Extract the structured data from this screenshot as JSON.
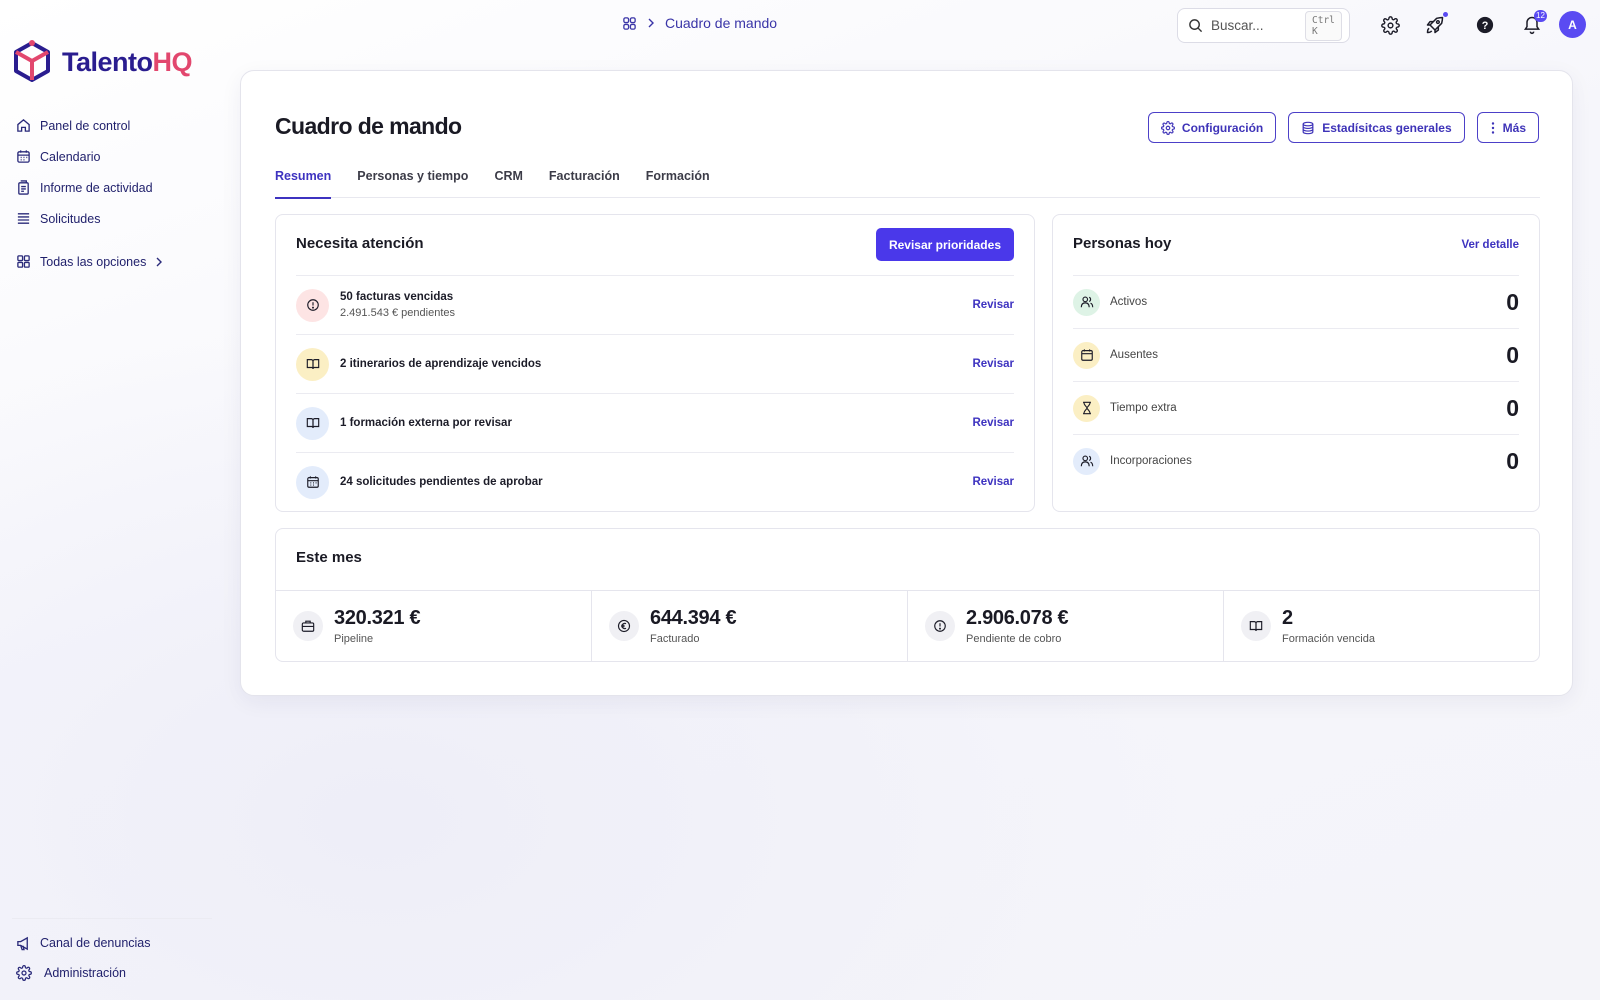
{
  "brand": {
    "name_part1": "Talento",
    "name_part2": "HQ",
    "color_primary": "#2a1d8f",
    "color_accent": "#e2476e"
  },
  "sidebar": {
    "items": [
      {
        "label": "Panel de control",
        "icon": "home-icon"
      },
      {
        "label": "Calendario",
        "icon": "calendar-icon"
      },
      {
        "label": "Informe de actividad",
        "icon": "report-icon"
      },
      {
        "label": "Solicitudes",
        "icon": "list-icon"
      }
    ],
    "all_options": {
      "label": "Todas las opciones",
      "icon": "grid-icon"
    },
    "bottom": [
      {
        "label": "Canal de denuncias",
        "icon": "megaphone-icon"
      },
      {
        "label": "Administración",
        "icon": "gear-icon"
      }
    ]
  },
  "topbar": {
    "breadcrumb": {
      "current": "Cuadro de mando"
    },
    "search": {
      "placeholder": "Buscar...",
      "shortcut": "Ctrl K"
    },
    "notifications_count": "12",
    "avatar_initial": "A"
  },
  "page": {
    "title": "Cuadro de mando",
    "actions": {
      "config": "Configuración",
      "stats": "Estadísitcas generales",
      "more": "Más"
    },
    "tabs": [
      "Resumen",
      "Personas y tiempo",
      "CRM",
      "Facturación",
      "Formación"
    ],
    "active_tab": "Resumen"
  },
  "attention": {
    "title": "Necesita atención",
    "button": "Revisar prioridades",
    "action_label": "Revisar",
    "items": [
      {
        "main": "50 facturas vencidas",
        "sub": "2.491.543 € pendientes",
        "icon": "alert-icon"
      },
      {
        "main": "2 itinerarios de aprendizaje vencidos",
        "sub": "",
        "icon": "book-icon"
      },
      {
        "main": "1 formación externa por revisar",
        "sub": "",
        "icon": "book-icon"
      },
      {
        "main": "24 solicitudes pendientes de aprobar",
        "sub": "",
        "icon": "calendar-icon"
      }
    ]
  },
  "people_today": {
    "title": "Personas hoy",
    "link": "Ver detalle",
    "rows": [
      {
        "label": "Activos",
        "value": "0",
        "icon": "users-icon"
      },
      {
        "label": "Ausentes",
        "value": "0",
        "icon": "calendar-icon"
      },
      {
        "label": "Tiempo extra",
        "value": "0",
        "icon": "hourglass-icon"
      },
      {
        "label": "Incorporaciones",
        "value": "0",
        "icon": "users-icon"
      }
    ]
  },
  "this_month": {
    "title": "Este mes",
    "stats": [
      {
        "value": "320.321 €",
        "label": "Pipeline",
        "icon": "briefcase-icon"
      },
      {
        "value": "644.394 €",
        "label": "Facturado",
        "icon": "euro-icon"
      },
      {
        "value": "2.906.078 €",
        "label": "Pendiente de cobro",
        "icon": "alert-icon"
      },
      {
        "value": "2",
        "label": "Formación vencida",
        "icon": "book-icon"
      }
    ]
  },
  "colors": {
    "accent": "#4a38ea",
    "link": "#3e33c0",
    "sidebar_text": "#1f1f6b"
  }
}
